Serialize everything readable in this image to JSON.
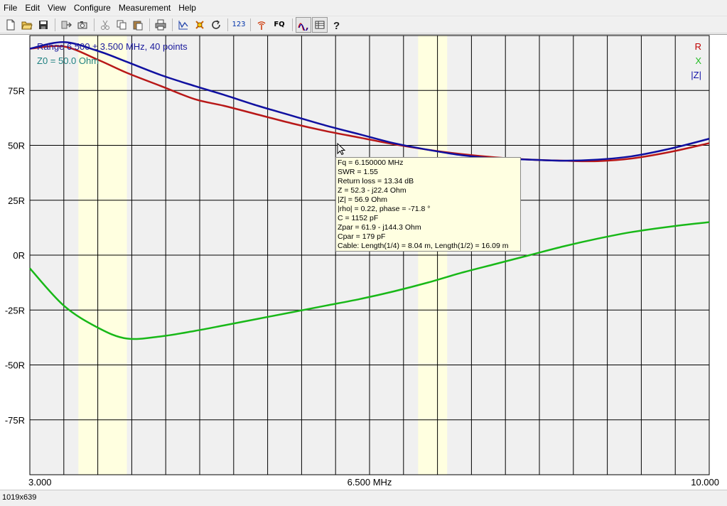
{
  "menu": [
    "File",
    "Edit",
    "View",
    "Configure",
    "Measurement",
    "Help"
  ],
  "toolbar": {
    "icons": [
      "new-file-icon",
      "open-folder-icon",
      "save-icon",
      "export-icon",
      "screenshot-icon",
      "cut-icon",
      "copy-icon",
      "paste-icon",
      "print-icon",
      "graph-icon",
      "settings-icon",
      "refresh-icon",
      "numbers-icon",
      "antenna-icon",
      "frequency-icon",
      "impedance-view-icon",
      "table-view-icon",
      "help-icon"
    ],
    "numbers_label": "123",
    "fq_label": "FQ"
  },
  "chart": {
    "range_text": "Range  6.500 ± 3.500 MHz, 40 points",
    "z0_text": "Z0 = 50.0 Ohm",
    "y_tick_labels": [
      "75R",
      "50R",
      "25R",
      "0R",
      "-25R",
      "-50R",
      "-75R"
    ],
    "x_labels": [
      "3.000",
      "6.500 MHz",
      "10.000"
    ],
    "legend": [
      {
        "name": "R",
        "color": "#c00000"
      },
      {
        "name": "X",
        "color": "#22bb22"
      },
      {
        "name": "|Z|",
        "color": "#1010a8"
      }
    ],
    "colors": {
      "R": "#b81818",
      "X": "#18b818",
      "Z": "#1010a0",
      "highlight": "#ffffe0",
      "grid_bg": "#f0f0f0"
    }
  },
  "chart_data": {
    "type": "line",
    "xlim": [
      3.0,
      10.0
    ],
    "ylim": [
      -100,
      100
    ],
    "y_ticks": [
      75,
      50,
      25,
      0,
      -25,
      -50,
      -75
    ],
    "highlight_bands": [
      [
        3.5,
        4.0
      ],
      [
        7.0,
        7.3
      ]
    ],
    "series": [
      {
        "name": "R",
        "color": "#b81818",
        "x": [
          3.0,
          3.35,
          3.7,
          4.0,
          4.35,
          4.7,
          5.0,
          5.35,
          5.7,
          6.05,
          6.4,
          6.75,
          7.1,
          7.45,
          7.8,
          8.15,
          8.5,
          8.85,
          9.2,
          9.6,
          10.0
        ],
        "y": [
          94,
          95,
          89,
          83,
          77,
          71,
          68,
          64,
          60,
          56.5,
          53.5,
          50.5,
          48,
          46,
          44.5,
          43.5,
          43,
          42.8,
          44,
          47,
          51
        ]
      },
      {
        "name": "X",
        "color": "#18b818",
        "x": [
          3.0,
          3.35,
          3.7,
          4.0,
          4.35,
          4.7,
          5.0,
          5.35,
          5.7,
          6.05,
          6.4,
          6.75,
          7.1,
          7.45,
          7.8,
          8.15,
          8.5,
          8.85,
          9.2,
          9.6,
          10.0
        ],
        "y": [
          -6,
          -23,
          -33,
          -38,
          -37,
          -34.5,
          -32,
          -29,
          -26,
          -23,
          -20,
          -16.5,
          -12.5,
          -8,
          -4,
          0,
          4,
          7.5,
          10.5,
          13,
          15
        ]
      },
      {
        "name": "|Z|",
        "color": "#1010a0",
        "x": [
          3.0,
          3.35,
          3.7,
          4.0,
          4.35,
          4.7,
          5.0,
          5.35,
          5.7,
          6.05,
          6.4,
          6.75,
          7.1,
          7.45,
          7.8,
          8.15,
          8.5,
          8.85,
          9.2,
          9.6,
          10.0
        ],
        "y": [
          94,
          97,
          93,
          88,
          82,
          77,
          73,
          68,
          63.5,
          59,
          55,
          51,
          48,
          45.5,
          44,
          43.5,
          43,
          43.5,
          45,
          48.5,
          53
        ]
      }
    ]
  },
  "tooltip": {
    "lines": [
      "Fq = 6.150000 MHz",
      "SWR = 1.55",
      "Return loss = 13.34 dB",
      "Z = 52.3 - j22.4 Ohm",
      "|Z| = 56.9 Ohm",
      "|rho| = 0.22, phase = -71.8 °",
      "C = 1152 pF",
      "Zpar = 61.9 - j144.3 Ohm",
      "Cpar = 179 pF",
      "Cable: Length(1/4) = 8.04 m, Length(1/2) = 16.09 m"
    ]
  },
  "status": {
    "text": "1019x639"
  }
}
